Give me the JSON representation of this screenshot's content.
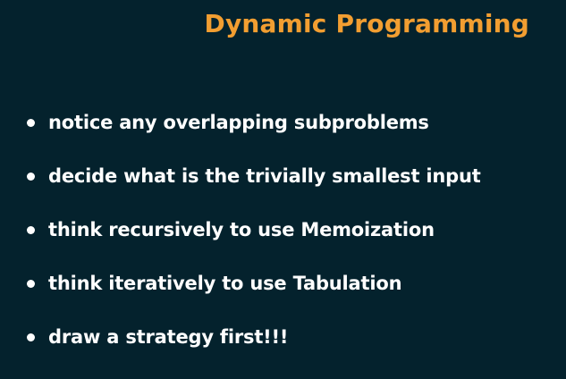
{
  "slide": {
    "title": "Dynamic Programming",
    "bullets": [
      "notice any overlapping subproblems",
      "decide what is the trivially smallest input",
      "think recursively to use Memoization",
      "think iteratively to use Tabulation",
      "draw a strategy first!!!"
    ]
  },
  "colors": {
    "background": "#04222d",
    "title": "#f29e31",
    "text": "#ffffff"
  }
}
